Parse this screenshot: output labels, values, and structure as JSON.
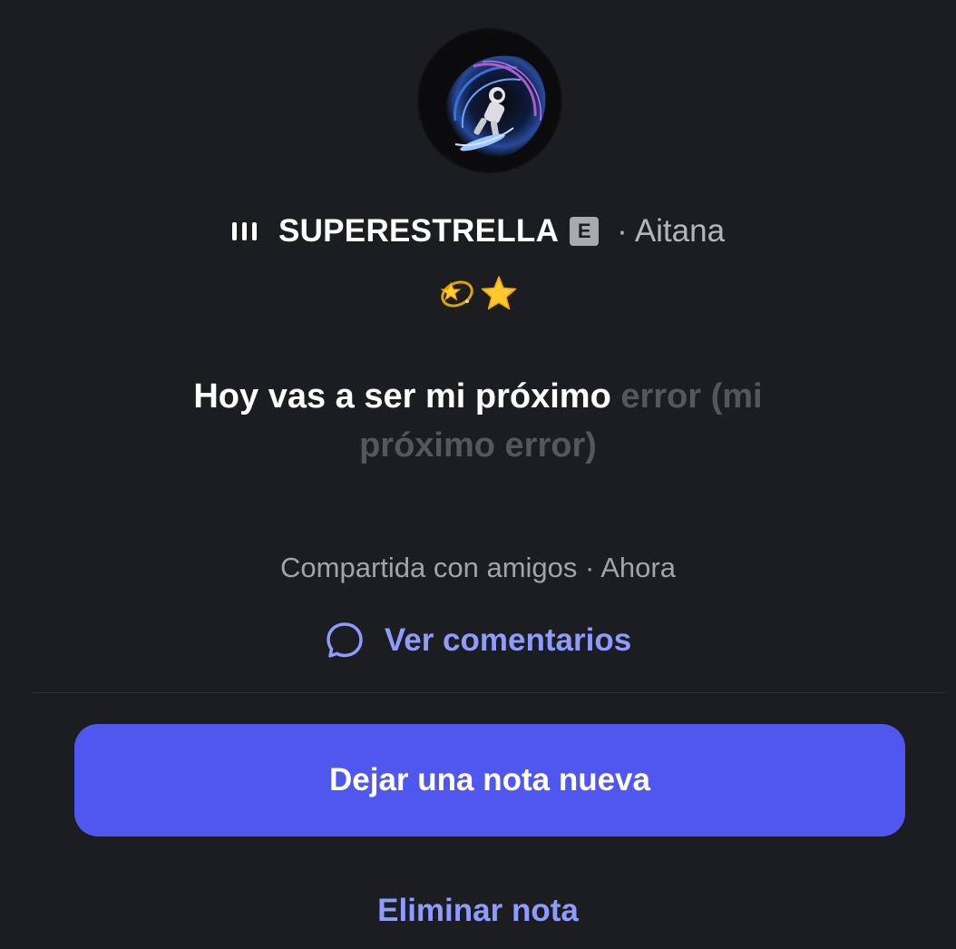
{
  "note": {
    "song_title": "SUPERESTRELLA",
    "explicit_badge": "E",
    "artist_separator": "·",
    "artist": "Aitana",
    "emojis": [
      "💫",
      "⭐"
    ],
    "lyric_sung": "Hoy vas a ser mi próximo",
    "lyric_unsung": "error (mi próximo error)",
    "meta": "Compartida con amigos · Ahora",
    "comments_label": "Ver comentarios"
  },
  "actions": {
    "new_note_label": "Dejar una nota nueva",
    "delete_label": "Eliminar nota"
  },
  "icons": {
    "track": "music-bars-icon",
    "comment": "speech-bubble-icon"
  },
  "colors": {
    "background": "#1c1d21",
    "accent": "#5057ee",
    "link": "#8e9bff",
    "unsung_text": "#55575d"
  }
}
